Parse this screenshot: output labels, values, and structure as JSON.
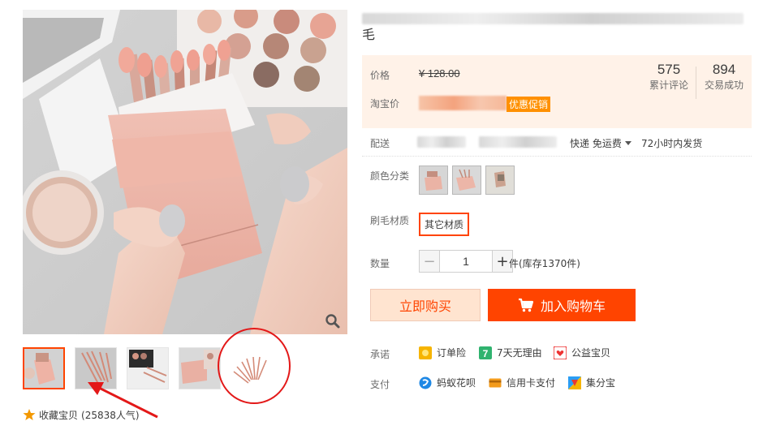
{
  "gallery": {
    "thumbnails": [
      "pouch-front",
      "brushes-angle",
      "brushes-eyeshadow",
      "pouch-palette",
      "brushes-fan"
    ],
    "active_index": 0,
    "favorite_label": "收藏宝贝",
    "favorite_count": "(25838人气)"
  },
  "product": {
    "title_tail": "毛",
    "title_fragment": "... 唇刷 ... 散 ..."
  },
  "price": {
    "label": "价格",
    "original": "¥ 128.00",
    "taobao_label": "淘宝价",
    "promo_tag": "优惠促销"
  },
  "stats": [
    {
      "value": "575",
      "label": "累计评论"
    },
    {
      "value": "894",
      "label": "交易成功"
    }
  ],
  "shipping": {
    "label": "配送",
    "method": "快递 免运费",
    "dispatch": "72小时内发货"
  },
  "options": {
    "color_label": "颜色分类",
    "bristle_label": "刷毛材质",
    "bristle_value": "其它材质"
  },
  "quantity": {
    "label": "数量",
    "value": "1",
    "stock": "件(库存1370件)",
    "minus": "−",
    "plus": "+"
  },
  "actions": {
    "buy_now": "立即购买",
    "add_cart": "加入购物车"
  },
  "promises": {
    "label": "承诺",
    "items": [
      "订单险",
      "7天无理由",
      "公益宝贝"
    ]
  },
  "payment": {
    "label": "支付",
    "items": [
      "蚂蚁花呗",
      "信用卡支付",
      "集分宝"
    ]
  },
  "colors": {
    "accent": "#ff4400",
    "promo": "#ff9000",
    "price_bg": "#fff2e8",
    "annotation": "#e31818"
  }
}
